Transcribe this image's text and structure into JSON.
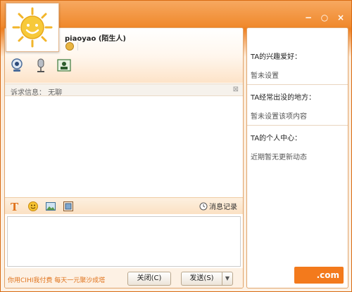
{
  "window": {
    "controls": [
      "−",
      "○",
      "×"
    ]
  },
  "profile": {
    "username": "piaoyao (陌生人)"
  },
  "request": {
    "label": "诉求信息：",
    "value": "无聊"
  },
  "toolbar": {
    "history_label": "消息记录"
  },
  "bottom": {
    "promo": "你用CIHI我付费 每天一元聚沙成塔",
    "close_label": "关闭(C)",
    "send_label": "发送(S)"
  },
  "sidebar": {
    "sections": [
      {
        "title": "TA的兴趣爱好：",
        "value": "暂未设置"
      },
      {
        "title": "TA经常出没的地方：",
        "value": "暂未设置该项内容"
      },
      {
        "title": "TA的个人中心：",
        "value": "近期暂无更新动态"
      }
    ],
    "logo_text": ".com"
  },
  "colors": {
    "accent": "#f08a2e",
    "panel_border": "#e0a46b",
    "promo": "#e0731c"
  },
  "icons": [
    "sun-avatar-icon",
    "webcam-icon",
    "microphone-icon",
    "contact-card-icon",
    "font-icon",
    "emoji-icon",
    "image-icon",
    "screenshot-icon",
    "clock-icon"
  ]
}
